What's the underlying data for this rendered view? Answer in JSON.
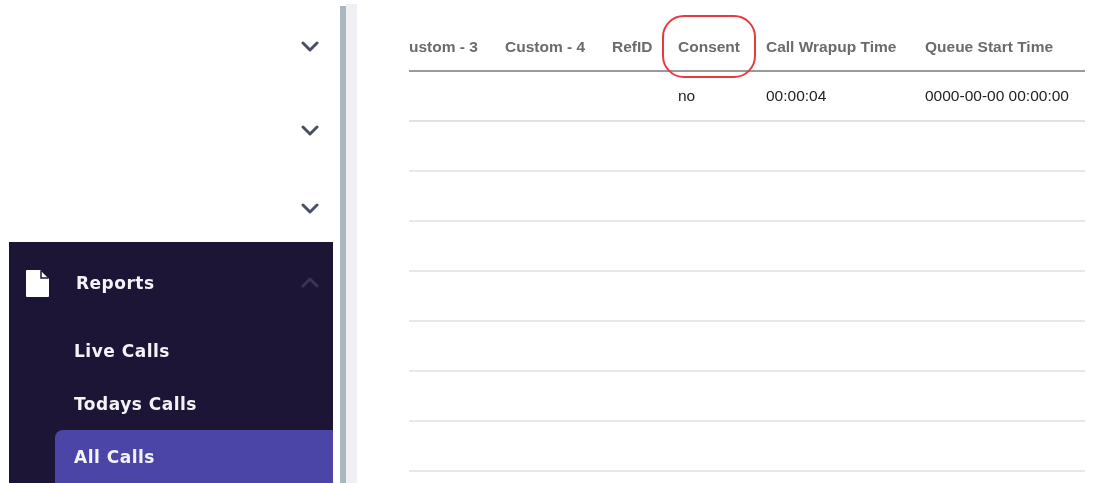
{
  "sidebar": {
    "items": [
      {
        "expanded": false
      },
      {
        "expanded": false
      },
      {
        "expanded": false
      },
      {
        "label": "Reports",
        "expanded": true,
        "children": [
          {
            "label": "Live Calls",
            "selected": false
          },
          {
            "label": "Todays Calls",
            "selected": false
          },
          {
            "label": "All Calls",
            "selected": true
          }
        ]
      }
    ]
  },
  "table": {
    "columns": [
      {
        "label": "ustom - 3",
        "highlighted": false
      },
      {
        "label": "Custom - 4",
        "highlighted": false
      },
      {
        "label": "RefID",
        "highlighted": false
      },
      {
        "label": "Consent",
        "highlighted": true
      },
      {
        "label": "Call Wrapup Time",
        "highlighted": false
      },
      {
        "label": "Queue Start Time",
        "highlighted": false
      }
    ],
    "rows": [
      {
        "cells": [
          null,
          null,
          null,
          "no",
          "00:00:04",
          "0000-00-00 00:00:00"
        ]
      }
    ]
  }
}
